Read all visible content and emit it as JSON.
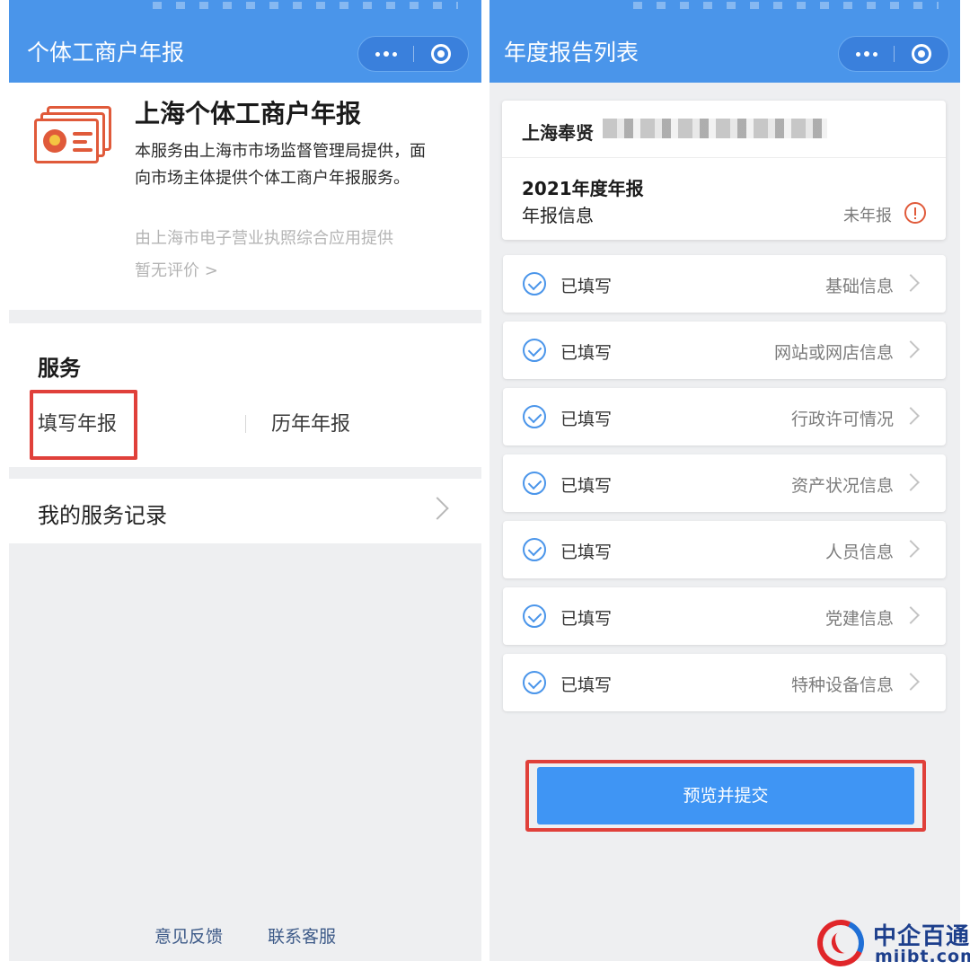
{
  "left": {
    "nav_title": "个体工商户年报",
    "intro": {
      "title": "上海个体工商户年报",
      "description": "本服务由上海市市场监督管理局提供，面向市场主体提供个体工商户年报服务。",
      "source": "由上海市电子营业执照综合应用提供",
      "rating": "暂无评价 >"
    },
    "service": {
      "title": "服务",
      "fill_report": "填写年报",
      "history_report": "历年年报"
    },
    "records_label": "我的服务记录",
    "footer": {
      "feedback": "意见反馈",
      "contact": "联系客服"
    }
  },
  "right": {
    "nav_title": "年度报告列表",
    "company_name": "上海奉贤",
    "year_label": "2021年度年报",
    "info_label": "年报信息",
    "status": "未年报",
    "sections": [
      {
        "status": "已填写",
        "label": "基础信息"
      },
      {
        "status": "已填写",
        "label": "网站或网店信息"
      },
      {
        "status": "已填写",
        "label": "行政许可情况"
      },
      {
        "status": "已填写",
        "label": "资产状况信息"
      },
      {
        "status": "已填写",
        "label": "人员信息"
      },
      {
        "status": "已填写",
        "label": "党建信息"
      },
      {
        "status": "已填写",
        "label": "特种设备信息"
      }
    ],
    "submit_label": "预览并提交"
  },
  "watermark": {
    "name": "中企百通",
    "domain": "miibt.com"
  },
  "colors": {
    "header_blue": "#4a95ea",
    "submit_blue": "#3f95f4",
    "highlight_red": "#e0403a",
    "icon_red": "#e05a3a"
  }
}
